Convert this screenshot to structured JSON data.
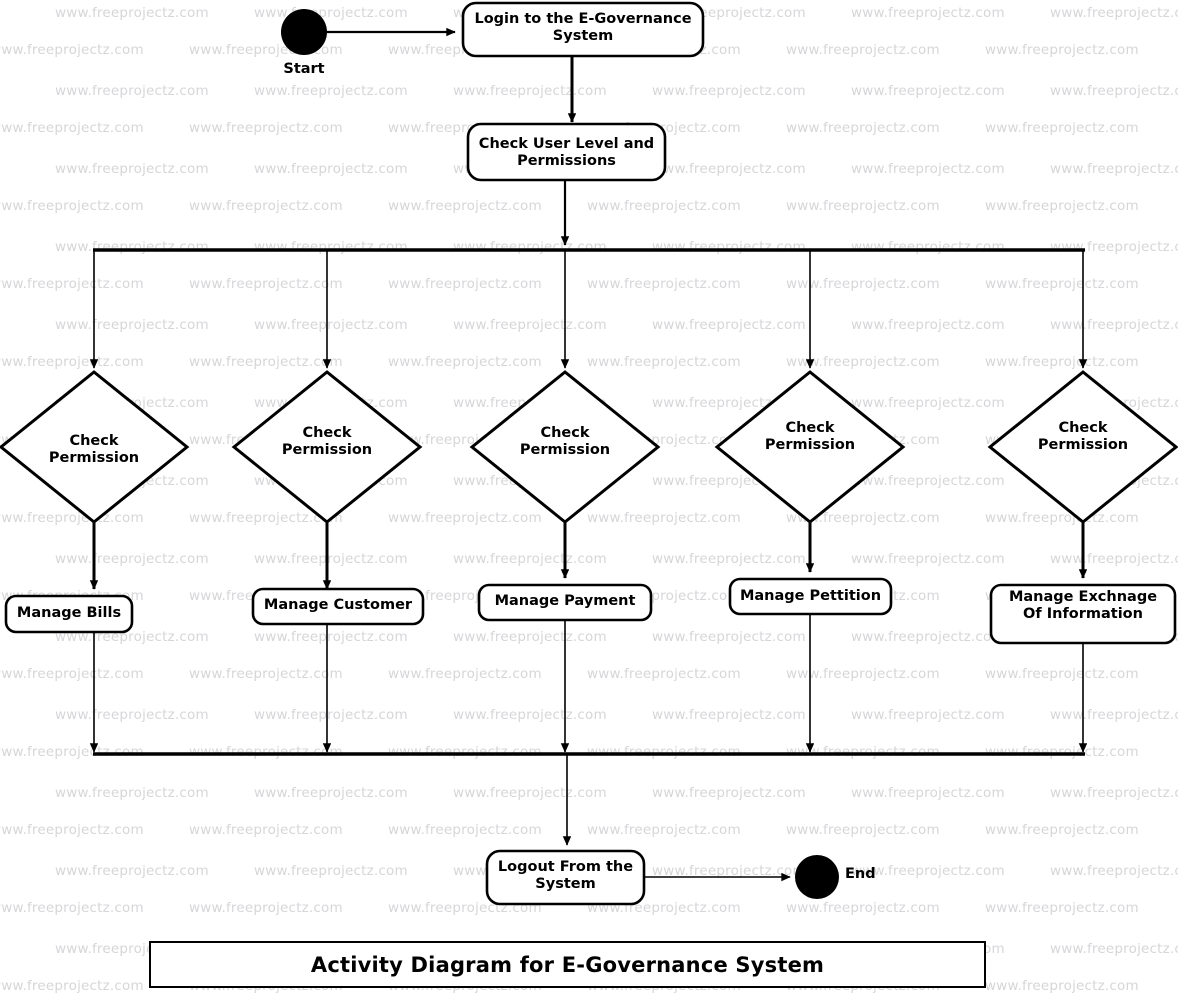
{
  "diagram": {
    "title": "Activity Diagram for E-Governance System",
    "watermark_text": "www.freeprojectz.com",
    "stroke_color": "#000000",
    "fill_color": "#ffffff",
    "watermark_color": "#d6d6d9",
    "nodes": {
      "start": {
        "label": "Start",
        "type": "initial-node"
      },
      "login": {
        "label": "Login to the E-Governance\nSystem",
        "type": "activity"
      },
      "check_user": {
        "label": "Check User Level and\nPermissions",
        "type": "activity"
      },
      "decision_1": {
        "label": "Check\nPermission",
        "type": "decision"
      },
      "decision_2": {
        "label": "Check\nPermission",
        "type": "decision"
      },
      "decision_3": {
        "label": "Check\nPermission",
        "type": "decision"
      },
      "decision_4": {
        "label": "Check\nPermission",
        "type": "decision"
      },
      "decision_5": {
        "label": "Check\nPermission",
        "type": "decision"
      },
      "manage_bills": {
        "label": "Manage Bills",
        "type": "activity"
      },
      "manage_customer": {
        "label": "Manage Customer",
        "type": "activity"
      },
      "manage_payment": {
        "label": "Manage Payment",
        "type": "activity"
      },
      "manage_pettition": {
        "label": "Manage Pettition",
        "type": "activity"
      },
      "manage_exchange": {
        "label": "Manage Exchnage\nOf Information",
        "type": "activity"
      },
      "logout": {
        "label": "Logout From the\nSystem",
        "type": "activity"
      },
      "end": {
        "label": "End",
        "type": "final-node"
      },
      "fork_bar": {
        "label": "",
        "type": "fork"
      },
      "join_bar": {
        "label": "",
        "type": "join"
      }
    },
    "branches": [
      {
        "decision": "Check Permission",
        "activity": "Manage Bills"
      },
      {
        "decision": "Check Permission",
        "activity": "Manage Customer"
      },
      {
        "decision": "Check Permission",
        "activity": "Manage Payment"
      },
      {
        "decision": "Check Permission",
        "activity": "Manage Pettition"
      },
      {
        "decision": "Check Permission",
        "activity": "Manage Exchnage Of Information"
      }
    ],
    "flow": [
      "Start -> Login to the E-Governance System",
      "Login to the E-Governance System -> Check User Level and Permissions",
      "Check User Level and Permissions -> Fork",
      "Fork -> Check Permission (x5)",
      "Check Permission -> Manage activity (x5)",
      "Manage activity -> Join (x5)",
      "Join -> Logout From the System",
      "Logout From the System -> End"
    ]
  }
}
